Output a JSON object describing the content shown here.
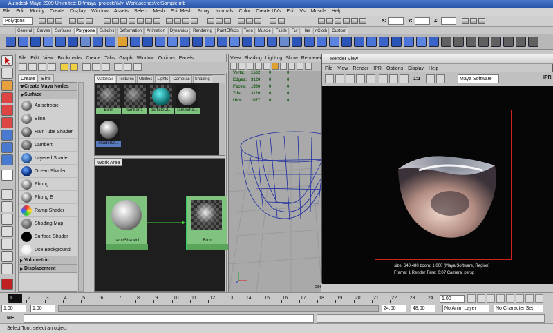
{
  "window_title": "Autodesk Maya 2009 Unlimited: D:\\maya_projects\\My_Work\\scenes\\refSample.mb",
  "main_menu": [
    "File",
    "Edit",
    "Modify",
    "Create",
    "Display",
    "Window",
    "Assets",
    "Select",
    "Mesh",
    "Edit Mesh",
    "Proxy",
    "Normals",
    "Color",
    "Create UVs",
    "Edit UVs",
    "Muscle",
    "Help"
  ],
  "status_line": {
    "mode": "Polygons",
    "x_label": "X:",
    "y_label": "Y:",
    "z_label": "Z:"
  },
  "shelf_tabs": [
    "General",
    "Curves",
    "Surfaces",
    "Polygons",
    "Subdivs",
    "Deformation",
    "Animation",
    "Dynamics",
    "Rendering",
    "PaintEffects",
    "Toon",
    "Muscle",
    "Fluids",
    "Fur",
    "Hair",
    "nCloth",
    "Custom"
  ],
  "shelf_active": "Polygons",
  "hypershade": {
    "menu": [
      "File",
      "Edit",
      "View",
      "Bookmarks",
      "Create",
      "Tabs",
      "Graph",
      "Window",
      "Options",
      "Panels"
    ],
    "left_tabs": [
      "Create",
      "Bins"
    ],
    "create_header": "Create Maya Nodes",
    "surface_header": "Surface",
    "surface_items": [
      "Anisotropic",
      "Blinn",
      "Hair Tube Shader",
      "Lambert",
      "Layered Shader",
      "Ocean Shader",
      "Phong",
      "Phong E",
      "Ramp Shader",
      "Shading Map",
      "Surface Shader",
      "Use Background"
    ],
    "volumetric_header": "Volumetric",
    "displacement_header": "Displacement",
    "material_tabs": [
      "Materials",
      "Textures",
      "Utilities",
      "Lights",
      "Cameras",
      "Shading"
    ],
    "materials": [
      "Blinn",
      "lambert1",
      "particleCl...",
      "rampSha...",
      "shaderGl..."
    ],
    "work_area_tab": "Work Area",
    "nodes": [
      {
        "label": "rampShader1"
      },
      {
        "label": "Blinn"
      }
    ]
  },
  "viewport": {
    "menu": [
      "View",
      "Shading",
      "Lighting",
      "Show",
      "Renderer"
    ],
    "hud": [
      {
        "label": "Verts:",
        "values": [
          "1562",
          "0",
          "0"
        ]
      },
      {
        "label": "Edges:",
        "values": [
          "3120",
          "0",
          "0"
        ]
      },
      {
        "label": "Faces:",
        "values": [
          "1560",
          "0",
          "0"
        ]
      },
      {
        "label": "Tris:",
        "values": [
          "3120",
          "0",
          "0"
        ]
      },
      {
        "label": "UVs:",
        "values": [
          "1677",
          "0",
          "0"
        ]
      }
    ],
    "camera_label": "persp"
  },
  "render_view": {
    "title": "Render View",
    "menu": [
      "File",
      "View",
      "Render",
      "IPR",
      "Options",
      "Display",
      "Help"
    ],
    "ratio": "1:1",
    "renderer": "Maya Software",
    "ipr": "IPR",
    "info_line1": "size: 640  480  zoom: 1.000     (Maya Software, Region)",
    "info_line2": "Frame: 1      Render Time: 0:07      Camera: persp"
  },
  "timeline": {
    "ticks": [
      "1",
      "2",
      "3",
      "4",
      "5",
      "6",
      "7",
      "8",
      "9",
      "10",
      "11",
      "12",
      "13",
      "14",
      "15",
      "16",
      "17",
      "18",
      "19",
      "20",
      "21",
      "22",
      "23",
      "24"
    ],
    "current": "1.00"
  },
  "range": {
    "start": "1.00",
    "inner_start": "1.00",
    "inner_end": "24.00",
    "end": "48.00",
    "anim_layer": "No Anim Layer",
    "char_set": "No Character Set"
  },
  "mel_label": "MEL",
  "help_line": "Select Tool: select an object",
  "colors": {
    "title_bar": "#2a55a8",
    "material_label": "#7fc37f",
    "wire": "#1a2aa0",
    "region": "#d02020"
  }
}
